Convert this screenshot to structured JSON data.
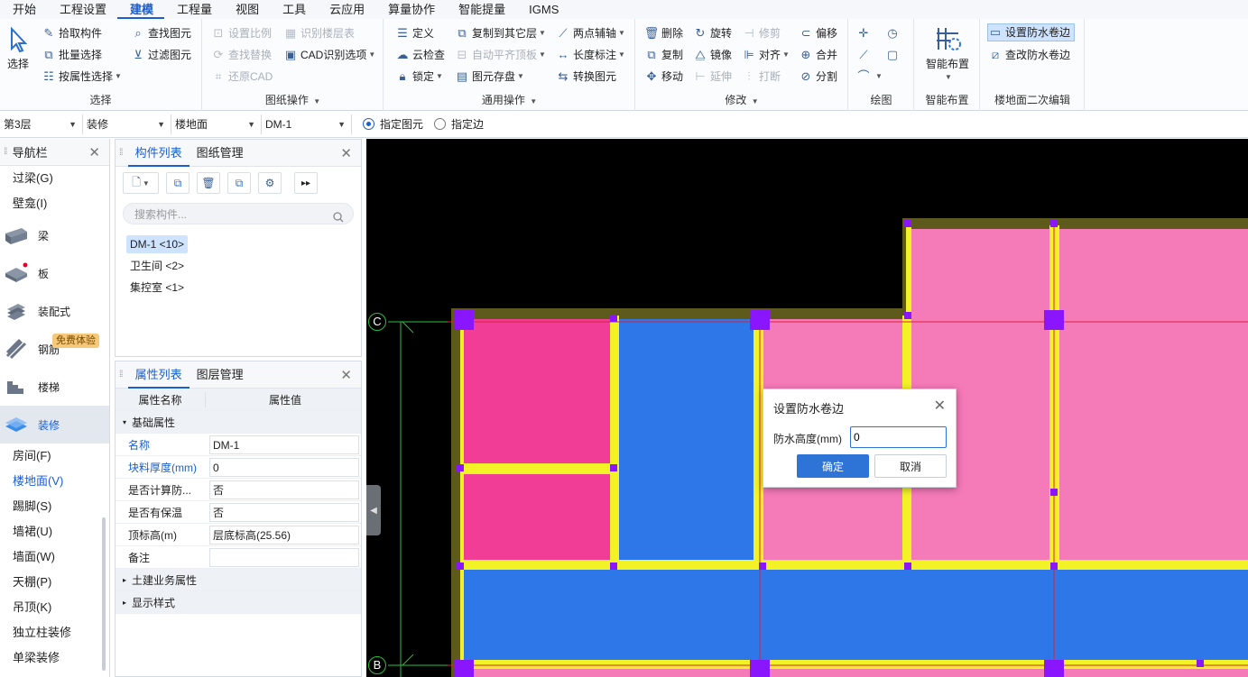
{
  "menu": [
    "开始",
    "工程设置",
    "建模",
    "工程量",
    "视图",
    "工具",
    "云应用",
    "算量协作",
    "智能提量",
    "IGMS"
  ],
  "menu_active": "建模",
  "ribbon": {
    "select": {
      "big": "选择",
      "items": [
        "拾取构件",
        "批量选择",
        "按属性选择",
        "查找图元",
        "过滤图元"
      ],
      "label": "选择"
    },
    "drawing": {
      "items": [
        "设置比例",
        "识别楼层表",
        "查找替换",
        "CAD识别选项",
        "还原CAD"
      ],
      "label": "图纸操作"
    },
    "common": {
      "items": [
        "定义",
        "复制到其它层",
        "两点辅轴",
        "云检查",
        "自动平齐顶板",
        "长度标注",
        "锁定",
        "图元存盘",
        "转换图元"
      ],
      "label": "通用操作"
    },
    "modify": {
      "items": [
        "删除",
        "旋转",
        "修剪",
        "偏移",
        "复制",
        "镜像",
        "对齐",
        "合并",
        "移动",
        "延伸",
        "打断",
        "分割"
      ],
      "label": "修改"
    },
    "draw": {
      "label": "绘图"
    },
    "smart": {
      "big": "智能布置",
      "label": "智能布置"
    },
    "floor_edit": {
      "items": [
        "设置防水卷边",
        "查改防水卷边"
      ],
      "label": "楼地面二次编辑"
    }
  },
  "filters": {
    "floor": "第3层",
    "type": "装修",
    "sub": "楼地面",
    "comp": "DM-1",
    "radio1": "指定图元",
    "radio2": "指定边"
  },
  "nav": {
    "title": "导航栏",
    "top_items": [
      "过梁(G)",
      "壁龛(I)"
    ],
    "categories": [
      "梁",
      "板",
      "装配式",
      "钢筋",
      "楼梯",
      "装修"
    ],
    "free_badge": "免费体验",
    "sub_items": [
      "房间(F)",
      "楼地面(V)",
      "踢脚(S)",
      "墙裙(U)",
      "墙面(W)",
      "天棚(P)",
      "吊顶(K)",
      "独立柱装修",
      "单梁装修"
    ]
  },
  "comp_panel": {
    "tabs": [
      "构件列表",
      "图纸管理"
    ],
    "search_placeholder": "搜索构件...",
    "items": [
      "DM-1 <10>",
      "卫生间 <2>",
      "集控室 <1>"
    ]
  },
  "props_panel": {
    "tabs": [
      "属性列表",
      "图层管理"
    ],
    "headers": [
      "属性名称",
      "属性值"
    ],
    "group_basic": "基础属性",
    "rows": [
      {
        "name": "名称",
        "value": "DM-1"
      },
      {
        "name": "块料厚度(mm)",
        "value": "0"
      },
      {
        "name": "是否计算防...",
        "value": "否"
      },
      {
        "name": "是否有保温",
        "value": "否"
      },
      {
        "name": "顶标高(m)",
        "value": "层底标高(25.56)"
      },
      {
        "name": "备注",
        "value": ""
      }
    ],
    "group_civil": "土建业务属性",
    "group_display": "显示样式"
  },
  "canvas": {
    "axis_c": "C",
    "axis_b": "B",
    "colors": {
      "pink_dark": "#f13d96",
      "pink_light": "#f57ab8",
      "blue": "#2d77e8",
      "yellow": "#f2f227",
      "purple": "#8a16ff",
      "olive": "#5e5a1c"
    }
  },
  "dialog": {
    "title": "设置防水卷边",
    "label": "防水高度(mm)",
    "value": "0",
    "ok": "确定",
    "cancel": "取消"
  }
}
